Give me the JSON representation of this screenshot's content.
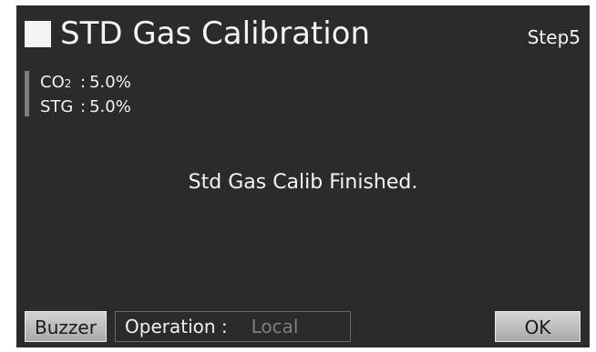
{
  "header": {
    "title": "STD Gas Calibration",
    "step": "Step5"
  },
  "readings": [
    {
      "name": "CO",
      "subscript": "2",
      "separator": ":",
      "value": "5.0%"
    },
    {
      "name": "STG",
      "subscript": "",
      "separator": ":",
      "value": "5.0%"
    }
  ],
  "message": "Std Gas Calib Finished.",
  "footer": {
    "buzzer_label": "Buzzer",
    "operation_label": "Operation :",
    "operation_value": "Local",
    "ok_label": "OK"
  },
  "colors": {
    "screen_background": "#2b2b2b",
    "text": "#f4f4f4",
    "reading_bar": "#7d7d7d",
    "button_face": "#bdbdbd",
    "inactive_value": "#7e7e7e"
  }
}
